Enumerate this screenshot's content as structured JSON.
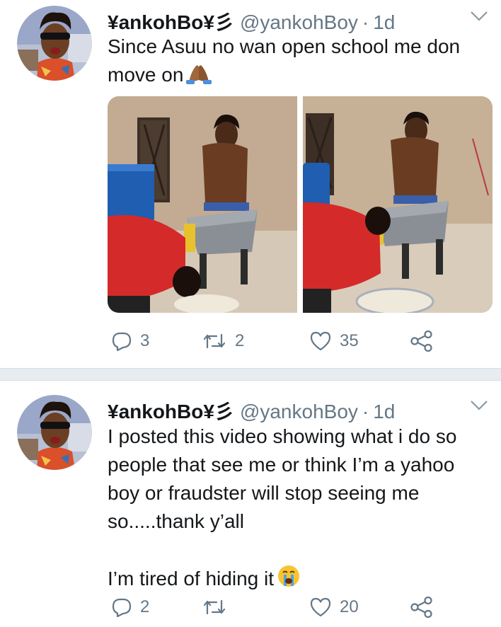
{
  "tweets": [
    {
      "display_name": "¥ankohBo¥彡",
      "handle": "@yankohBoy",
      "separator": "·",
      "time": "1d",
      "text_lines": [
        "Since Asuu no wan open school me don",
        "move on"
      ],
      "emoji": "folded-hands-emoji",
      "replies": "3",
      "retweets": "2",
      "likes": "35"
    },
    {
      "display_name": "¥ankohBo¥彡",
      "handle": "@yankohBoy",
      "separator": "·",
      "time": "1d",
      "text_lines": [
        "I posted this video showing what i do so",
        "people that see me or think I’m a yahoo",
        "boy or fraudster will stop seeing me",
        "so.....thank y’all",
        "",
        "I’m tired of hiding it"
      ],
      "emoji": "crying-face-emoji",
      "replies": "2",
      "retweets": "",
      "likes": "20"
    }
  ],
  "icons": {
    "reply": "reply-icon",
    "retweet": "retweet-icon",
    "like": "heart-icon",
    "share": "share-icon",
    "menu": "chevron-down-icon"
  },
  "colors": {
    "text": "#14171a",
    "muted": "#657786",
    "separator": "#e6ecf0"
  }
}
